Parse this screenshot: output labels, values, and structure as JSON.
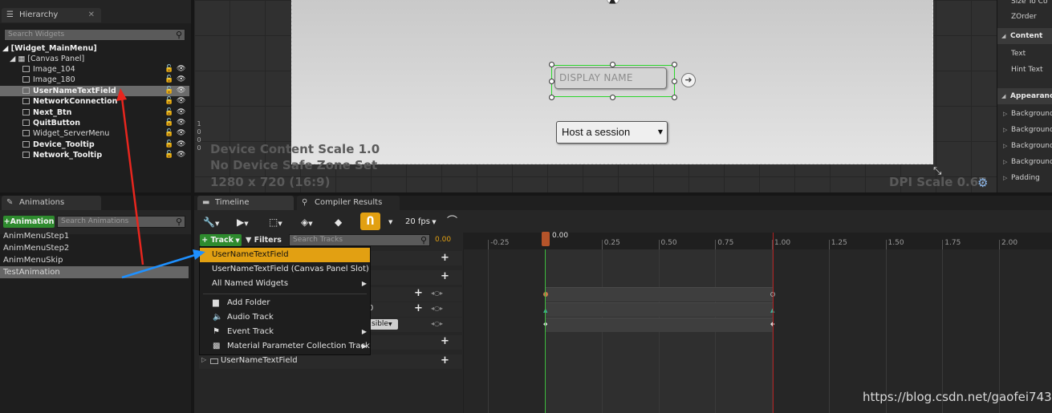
{
  "hierarchy": {
    "tab_label": "Hierarchy",
    "search_placeholder": "Search Widgets",
    "root": "[Widget_MainMenu]",
    "canvas": "[Canvas Panel]",
    "items": [
      {
        "label": "Image_104",
        "bold": false
      },
      {
        "label": "Image_180",
        "bold": false
      },
      {
        "label": "UserNameTextField",
        "bold": true,
        "selected": true
      },
      {
        "label": "NetworkConnection",
        "bold": true
      },
      {
        "label": "Next_Btn",
        "bold": true
      },
      {
        "label": "QuitButton",
        "bold": true
      },
      {
        "label": "Widget_ServerMenu",
        "bold": false
      },
      {
        "label": "Device_Tooltip",
        "bold": true
      },
      {
        "label": "Network_Tooltip",
        "bold": true
      }
    ]
  },
  "viewport": {
    "ruler_digits": [
      "1",
      "0",
      "0",
      "0"
    ],
    "textfield_hint": "DISPLAY NAME",
    "dropdown_value": "Host a session",
    "info_line1": "Device Content Scale 1.0",
    "info_line2": "No Device Safe Zone Set",
    "info_line3": "1280 x 720 (16:9)",
    "dpi_scale": "DPI Scale 0.67"
  },
  "details": {
    "rows": [
      {
        "label": "Size To Co",
        "type": "prop"
      },
      {
        "label": "ZOrder",
        "type": "prop"
      },
      {
        "label": "Content",
        "type": "category"
      },
      {
        "label": "Text",
        "type": "prop"
      },
      {
        "label": "Hint Text",
        "type": "prop"
      },
      {
        "label": "Appearance",
        "type": "category"
      },
      {
        "label": "Background",
        "type": "sub"
      },
      {
        "label": "Background",
        "type": "sub"
      },
      {
        "label": "Background",
        "type": "sub"
      },
      {
        "label": "Background",
        "type": "sub"
      },
      {
        "label": "Padding",
        "type": "sub"
      }
    ]
  },
  "animations": {
    "tab_label": "Animations",
    "add_label": "+Animation",
    "search_placeholder": "Search Animations",
    "items": [
      "AnimMenuStep1",
      "AnimMenuStep2",
      "AnimMenuSkip",
      "TestAnimation"
    ],
    "selected_index": 3
  },
  "timeline": {
    "tabs": [
      "Timeline",
      "Compiler Results"
    ],
    "fps": "20 fps",
    "track_button": "+ Track",
    "filters_button": "Filters",
    "search_placeholder": "Search Tracks",
    "current_time": "0.00",
    "playhead_label": "0.00",
    "ruler": [
      "-0.25",
      "0.25",
      "0.50",
      "0.75",
      "1.00",
      "1.25",
      "1.50",
      "1.75",
      "2.00"
    ],
    "partial_visibility": "sible",
    "partial_zero": "0",
    "bottom_track": "UserNameTextField"
  },
  "track_menu": {
    "items": [
      {
        "label": "UserNameTextField",
        "highlight": true
      },
      {
        "label": "UserNameTextField (Canvas Panel Slot)"
      },
      {
        "label": "All Named Widgets",
        "submenu": true
      },
      {
        "label": "Add Folder",
        "icon": "folder-icon"
      },
      {
        "label": "Audio Track",
        "icon": "speaker-icon"
      },
      {
        "label": "Event Track",
        "icon": "flag-icon",
        "submenu": true
      },
      {
        "label": "Material Parameter Collection Track",
        "icon": "material-icon",
        "submenu": true
      }
    ]
  },
  "watermark": "https://blog.csdn.net/gaofei7439",
  "colors": {
    "accent_orange": "#e2a012",
    "add_green": "#2e8b2e",
    "annotation_red": "#e8261e",
    "annotation_blue": "#1e90ff",
    "selection_green": "#2bd62b"
  }
}
